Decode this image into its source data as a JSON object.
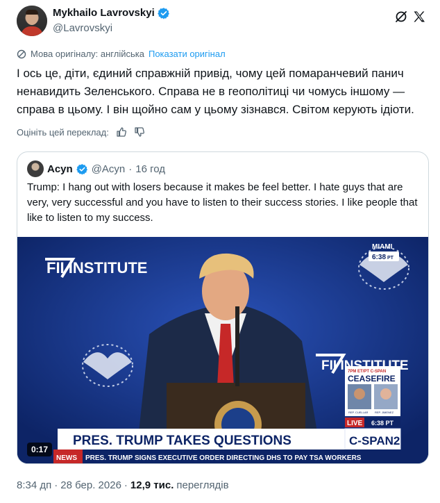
{
  "author": {
    "name": "Mykhailo Lavrovskyi",
    "handle": "@Lavrovskyi"
  },
  "translation": {
    "original_language": "Мова оригіналу: англійська",
    "show_original": "Показати оригінал"
  },
  "post": {
    "text": "І ось це, діти, єдиний справжній привід, чому цей помаранчевий панич ненавидить Зеленського. Справа не в геополітиці чи чомусь іншому — справа в цьому. І він щойно сам у цьому зізнався. Світом керують ідіоти."
  },
  "rate": {
    "label": "Оцініть цей переклад:"
  },
  "quote": {
    "name": "Acyn",
    "handle": "@Acyn",
    "separator": "·",
    "time": "16 год",
    "text": "Trump: I hang out with losers because it makes be feel better. I hate guys that are very, very successful and you have to listen to their success stories. I like people that like to listen to my success."
  },
  "video": {
    "duration": "0:17",
    "location": "MIAMI",
    "clock": "6:38",
    "clock_suffix": "PT",
    "brand_left": "FII INSTITUTE",
    "brand_right": "FII INSTITUTE",
    "live": "LIVE",
    "live_time": "6:38 PT",
    "ceasefire_top": "7PM ET/PT C-SPAN",
    "ceasefire": "CEASEFIRE",
    "rep_left": "REP. CUELLAR",
    "rep_right": "REP. JIMENEZ",
    "headline": "PRES. TRUMP TAKES QUESTIONS",
    "network": "C-SPAN2",
    "ticker_label": "NEWS",
    "ticker": "PRES. TRUMP SIGNS EXECUTIVE ORDER DIRECTING DHS TO PAY TSA WORKERS"
  },
  "footer": {
    "time": "8:34 дп",
    "dot": "·",
    "date": "28 бер. 2026",
    "views_count": "12,9 тис.",
    "views_label": "переглядів"
  },
  "colors": {
    "accent": "#1d9bf0",
    "text": "#0f1419",
    "secondary": "#536471",
    "border": "#cfd9de",
    "video_bg": "#11307a"
  }
}
